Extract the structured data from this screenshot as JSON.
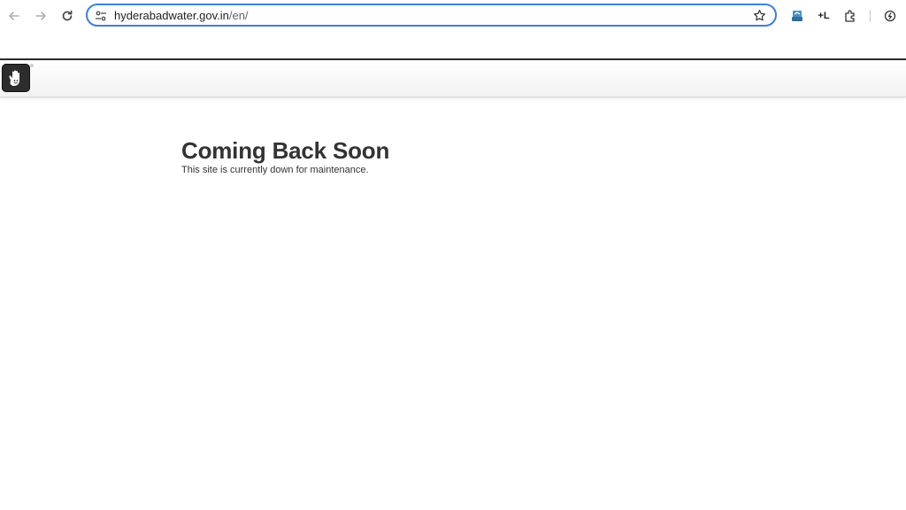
{
  "browser": {
    "url_host": "hyderabadwater.gov.in",
    "url_path": "/en/",
    "extensions": [
      "stack-icon",
      "+L",
      "puzzle-icon",
      "power-icon"
    ],
    "extension_text": "+L"
  },
  "page": {
    "headline": "Coming Back Soon",
    "subline": "This site is currently down for maintenance."
  },
  "colors": {
    "omnibox_border": "#3f7fd6",
    "headline": "#333333"
  }
}
